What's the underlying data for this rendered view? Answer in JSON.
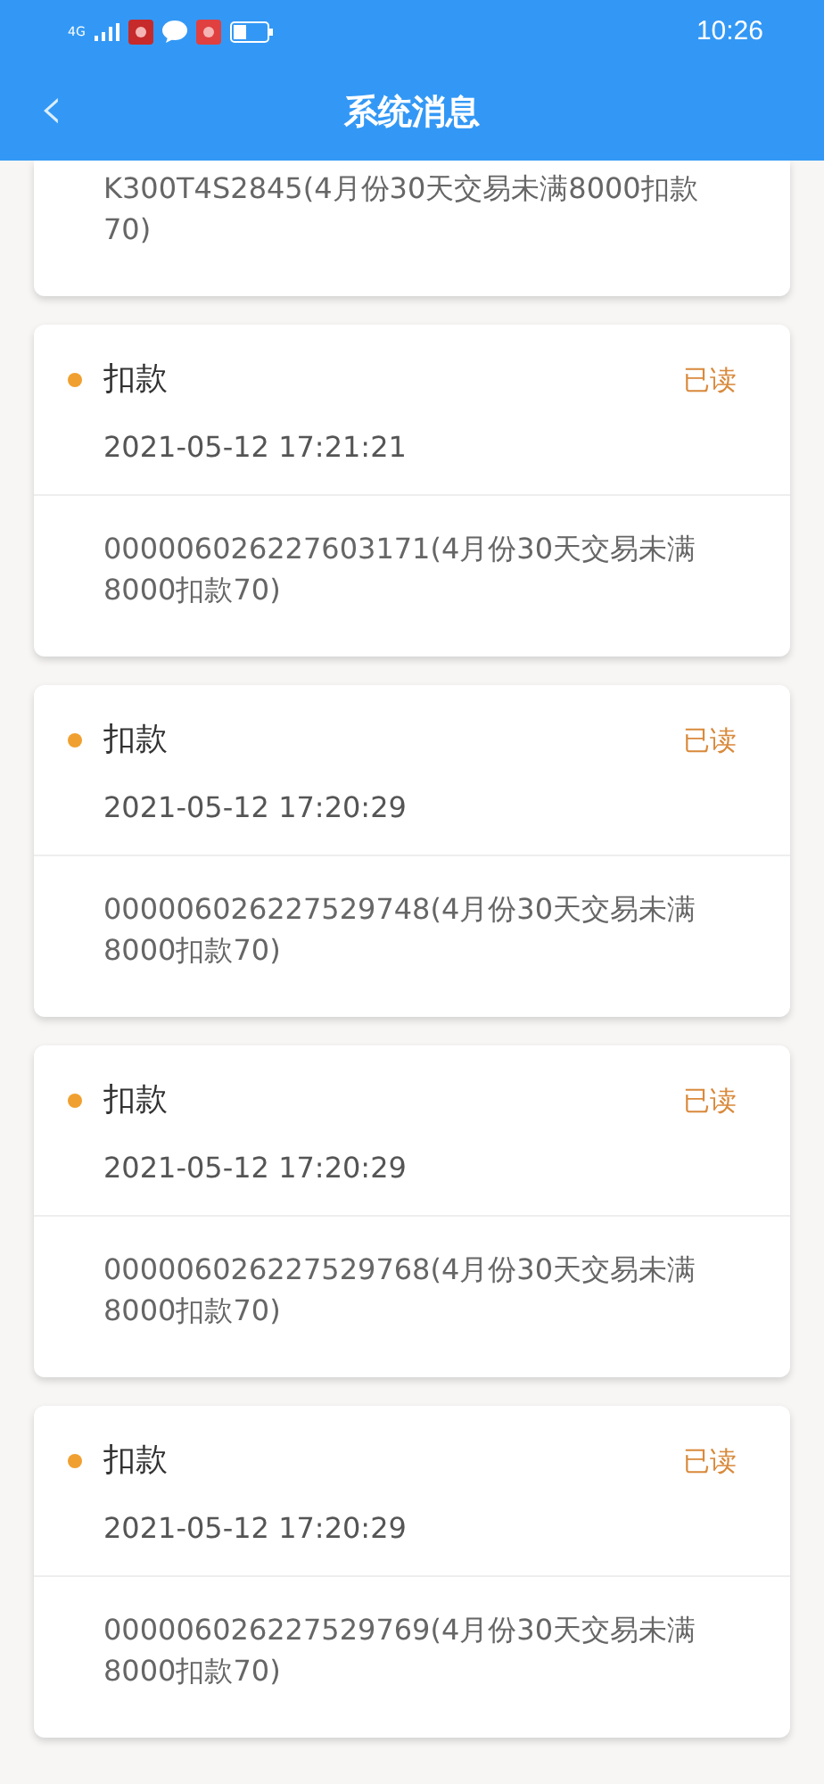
{
  "status_bar": {
    "network": "4G",
    "time": "10:26"
  },
  "header": {
    "back": "‹",
    "title": "系统消息"
  },
  "partial_message": {
    "body": "K300T4S2845(4月份30天交易未满8000扣款70)"
  },
  "messages": [
    {
      "title": "扣款",
      "status": "已读",
      "read": true,
      "time": "2021-05-12 17:21:21",
      "body": "000006026227603171(4月份30天交易未满8000扣款70)"
    },
    {
      "title": "扣款",
      "status": "已读",
      "read": true,
      "time": "2021-05-12 17:20:29",
      "body": "000006026227529748(4月份30天交易未满8000扣款70)"
    },
    {
      "title": "扣款",
      "status": "已读",
      "read": true,
      "time": "2021-05-12 17:20:29",
      "body": "000006026227529768(4月份30天交易未满8000扣款70)"
    },
    {
      "title": "扣款",
      "status": "已读",
      "read": true,
      "time": "2021-05-12 17:20:29",
      "body": "000006026227529769(4月份30天交易未满8000扣款70)"
    }
  ]
}
